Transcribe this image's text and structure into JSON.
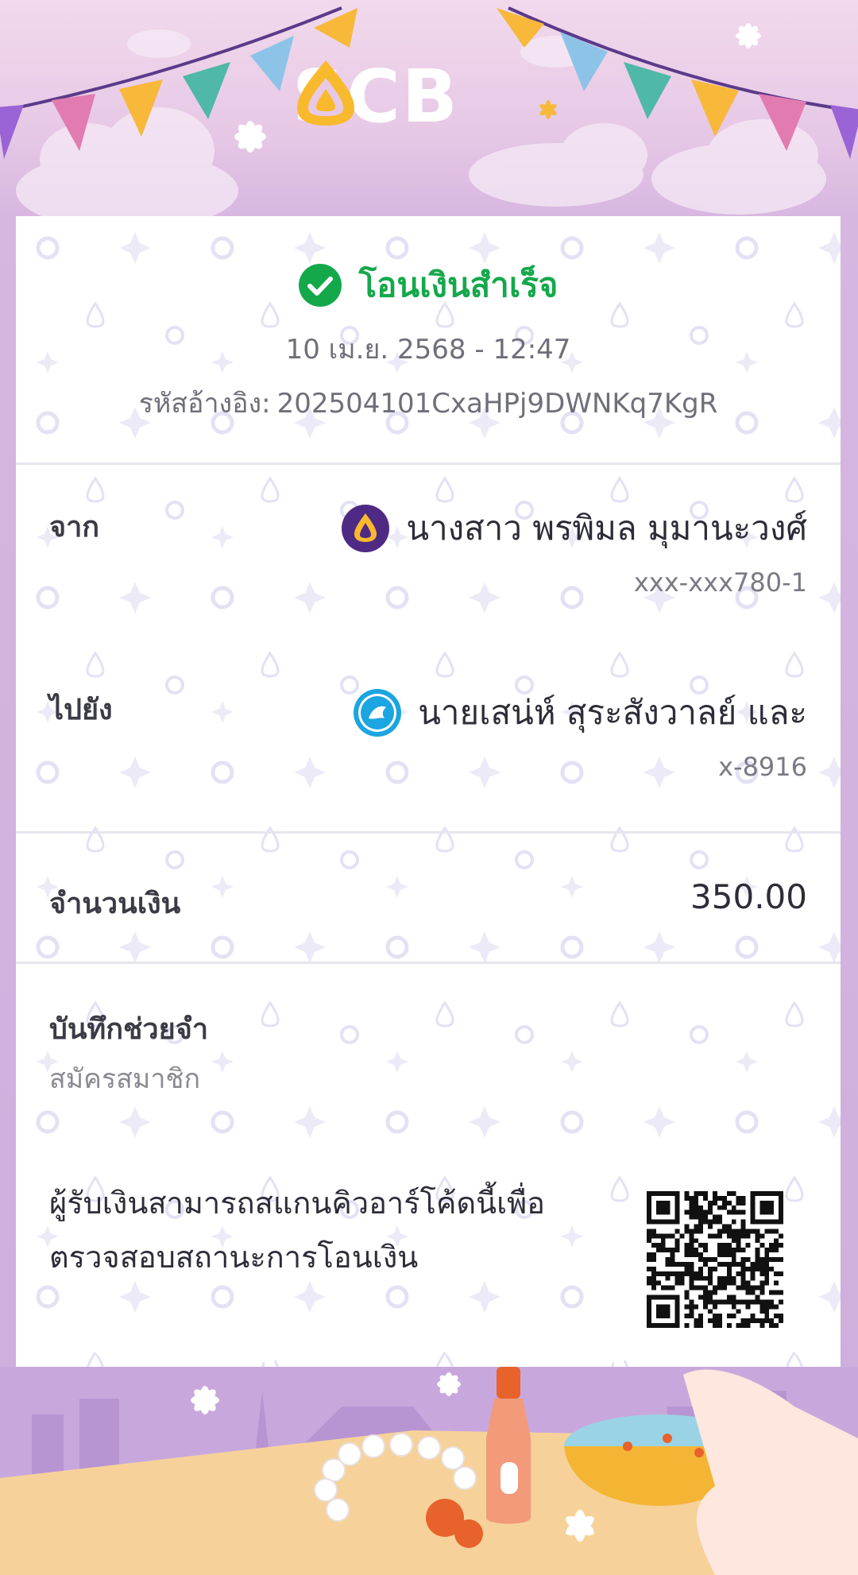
{
  "brand": {
    "name": "SCB",
    "primary": "#4e2a84",
    "accent": "#f9b92c",
    "success": "#14a84b"
  },
  "status": {
    "text": "โอนเงินสำเร็จ",
    "icon": "check-circle-icon"
  },
  "datetime": "10 เม.ย. 2568 - 12:47",
  "reference": {
    "label": "รหัสอ้างอิง:",
    "value": "202504101CxaHPj9DWNKq7KgR"
  },
  "from": {
    "label": "จาก",
    "name": "นางสาว พรพิมล มุมานะวงศ์",
    "account": "xxx-xxx780-1",
    "bank_icon": "scb-bank-icon"
  },
  "to": {
    "label": "ไปยัง",
    "name": "นายเสน่ห์ สุระสังวาลย์ และ",
    "account": "x-8916",
    "bank_icon": "krungthai-bank-icon"
  },
  "amount": {
    "label": "จำนวนเงิน",
    "value": "350.00"
  },
  "memo": {
    "label": "บันทึกช่วยจำ",
    "value": "สมัครสมาชิก"
  },
  "qr_note": {
    "text": "ผู้รับเงินสามารถสแกนคิวอาร์โค้ดนี้เพื่อตรวจสอบสถานะการโอนเงิน",
    "icon": "qr-code-icon"
  }
}
